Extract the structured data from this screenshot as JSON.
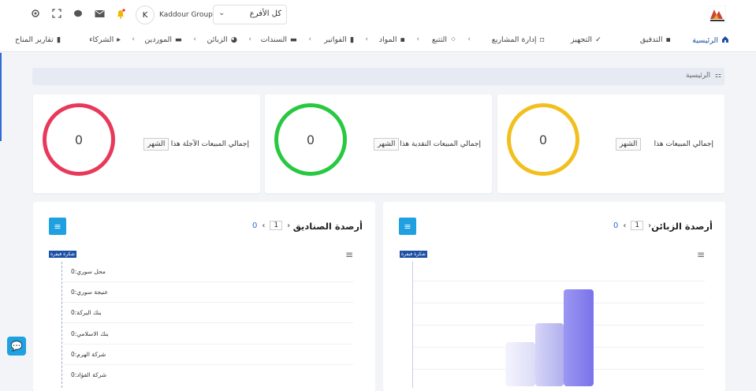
{
  "header": {
    "branch_select": "كل الأفرع",
    "user_initial": "K",
    "user_name": "Kaddour Group"
  },
  "nav": {
    "items": [
      {
        "label": "الرئيسية",
        "icon": "home-icon"
      },
      {
        "label": "التدقيق",
        "icon": "audit-icon"
      },
      {
        "label": "التجهيز",
        "icon": "check-icon"
      },
      {
        "label": "إدارة المشاريع",
        "icon": "projects-icon"
      },
      {
        "label": "التتبع",
        "icon": "tracking-icon"
      },
      {
        "label": "المواد",
        "icon": "materials-icon"
      },
      {
        "label": "الفواتير",
        "icon": "invoices-icon"
      },
      {
        "label": "السندات",
        "icon": "vouchers-icon"
      },
      {
        "label": "الزبائن",
        "icon": "customers-icon"
      },
      {
        "label": "الموردين",
        "icon": "suppliers-icon"
      },
      {
        "label": "الشركاء",
        "icon": "partners-icon"
      },
      {
        "label": "تقارير المناح",
        "icon": "reports-icon"
      }
    ]
  },
  "breadcrumb": {
    "label": "الرئيسية"
  },
  "cards": [
    {
      "label": "إجمالي المبيعات هذا",
      "period": "الشهر",
      "value": "0",
      "color": "#f2c01e"
    },
    {
      "label": "إجمالي المبيعات النقدية هذا",
      "period": "الشهر",
      "value": "0",
      "color": "#28c840"
    },
    {
      "label": "إجمالي المبيعات الآجلة هذا",
      "period": "الشهر",
      "value": "0",
      "color": "#e8395a"
    }
  ],
  "panels": {
    "customers": {
      "title": "أرصدة الزبائن",
      "page": "1",
      "count": "0",
      "legend": "شكرة فيفرة"
    },
    "boxes": {
      "title": "أرصدة الصناديق",
      "page": "1",
      "count": "0",
      "legend": "شكرة فيفرة",
      "rows": [
        "محل سوري:0",
        "عنيجة سوري:0",
        "بنك البركة:0",
        "بنك الاسلامي:0",
        "شركة الهرم:0",
        "شركة الفؤاد:0"
      ]
    }
  }
}
